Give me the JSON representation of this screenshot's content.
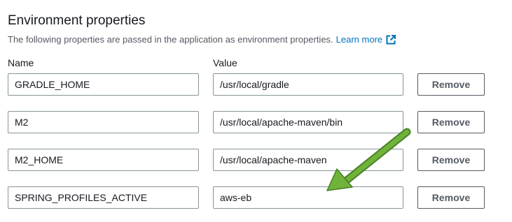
{
  "section": {
    "title": "Environment properties",
    "description": "The following properties are passed in the application as environment properties.",
    "learn_more": "Learn more",
    "name_label": "Name",
    "value_label": "Value"
  },
  "properties": [
    {
      "name": "GRADLE_HOME",
      "value": "/usr/local/gradle",
      "remove_label": "Remove"
    },
    {
      "name": "M2",
      "value": "/usr/local/apache-maven/bin",
      "remove_label": "Remove"
    },
    {
      "name": "M2_HOME",
      "value": "/usr/local/apache-maven",
      "remove_label": "Remove"
    },
    {
      "name": "SPRING_PROFILES_ACTIVE",
      "value": "aws-eb",
      "remove_label": "Remove"
    }
  ],
  "icons": {
    "learn_more": "external-link-icon",
    "annotation": "green-arrow-icon"
  },
  "colors": {
    "link": "#0073bb",
    "arrow": "#6fb33b",
    "border": "#879596",
    "button_text": "#545b64"
  }
}
